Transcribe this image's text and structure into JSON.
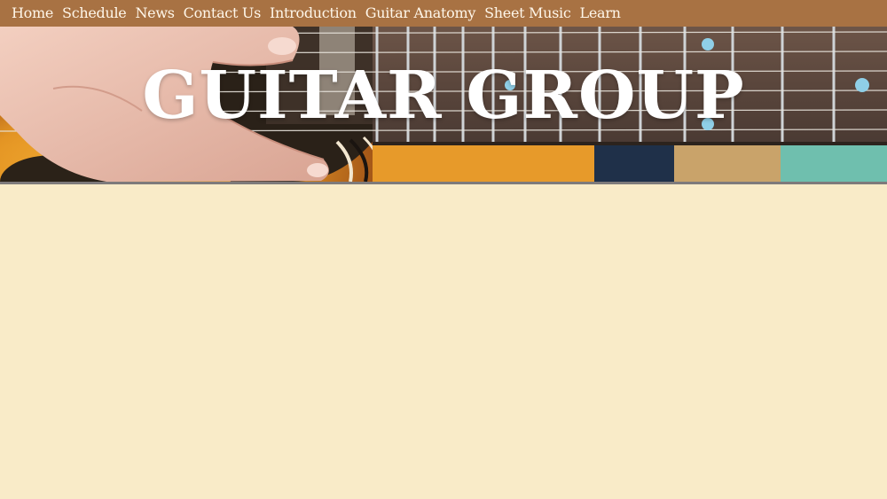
{
  "nav": {
    "items": [
      {
        "label": "Home"
      },
      {
        "label": "Schedule"
      },
      {
        "label": "News"
      },
      {
        "label": "Contact Us"
      },
      {
        "label": "Introduction"
      },
      {
        "label": "Guitar Anatomy"
      },
      {
        "label": "Sheet Music"
      },
      {
        "label": "Learn"
      }
    ]
  },
  "hero": {
    "title": "GUITAR GROUP"
  },
  "colors": {
    "nav_background": "#a87243",
    "page_background": "#f9ebc8",
    "nav_text": "#fff7ea",
    "hero_title": "#ffffff"
  }
}
